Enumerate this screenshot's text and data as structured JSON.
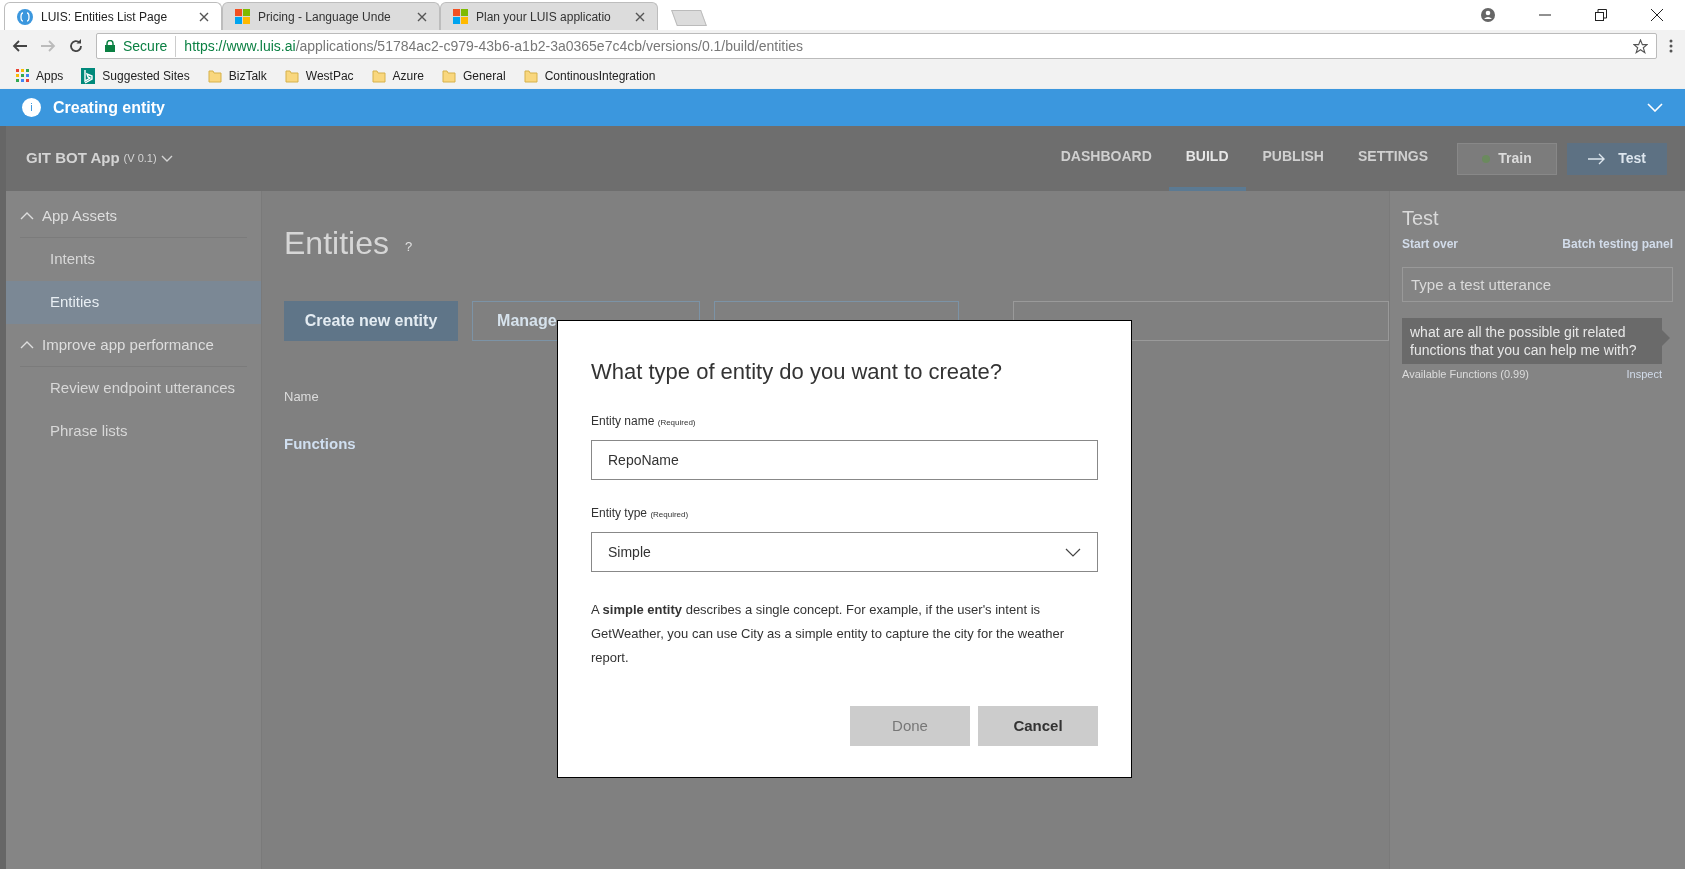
{
  "browser": {
    "tabs": [
      {
        "title": "LUIS: Entities List Page",
        "selected": true
      },
      {
        "title": "Pricing - Language Unde",
        "selected": false
      },
      {
        "title": "Plan your LUIS applicatio",
        "selected": false
      }
    ],
    "secure_label": "Secure",
    "url_host": "https://www.luis.ai",
    "url_path": "/applications/51784ac2-c979-43b6-a1b2-3a0365e7c4cb/versions/0.1/build/entities",
    "bookmarks": [
      {
        "label": "Apps",
        "kind": "apps"
      },
      {
        "label": "Suggested Sites",
        "kind": "bing"
      },
      {
        "label": "BizTalk",
        "kind": "folder"
      },
      {
        "label": "WestPac",
        "kind": "folder"
      },
      {
        "label": "Azure",
        "kind": "folder"
      },
      {
        "label": "General",
        "kind": "folder"
      },
      {
        "label": "ContinousIntegration",
        "kind": "folder"
      }
    ]
  },
  "banner": {
    "icon": "i",
    "text": "Creating entity"
  },
  "header": {
    "app_name": "GIT BOT App",
    "version": "(V 0.1)",
    "nav": [
      {
        "label": "DASHBOARD",
        "selected": false
      },
      {
        "label": "BUILD",
        "selected": true
      },
      {
        "label": "PUBLISH",
        "selected": false
      },
      {
        "label": "SETTINGS",
        "selected": false
      }
    ],
    "train": "Train",
    "test": "Test"
  },
  "sidebar": [
    {
      "label": "App Assets",
      "kind": "section"
    },
    {
      "label": "Intents",
      "kind": "item",
      "selected": false
    },
    {
      "label": "Entities",
      "kind": "item",
      "selected": true
    },
    {
      "label": "Improve app performance",
      "kind": "section"
    },
    {
      "label": "Review endpoint utterances",
      "kind": "item",
      "selected": false
    },
    {
      "label": "Phrase lists",
      "kind": "item",
      "selected": false
    }
  ],
  "main": {
    "title": "Entities",
    "help": "?",
    "create_button": "Create new entity",
    "manage_button": "Manage",
    "name_column": "Name",
    "rows": [
      "Functions"
    ]
  },
  "test_panel": {
    "title": "Test",
    "start_over": "Start over",
    "batch": "Batch testing panel",
    "placeholder": "Type a test utterance",
    "utterance": "what are all the possible git related functions that you can help me with?",
    "result": "Available Functions (0.99)",
    "inspect": "Inspect"
  },
  "dialog": {
    "title": "What type of entity do you want to create?",
    "name_label": "Entity name",
    "name_required": "(Required)",
    "name_value": "RepoName",
    "type_label": "Entity type",
    "type_required": "(Required)",
    "type_value": "Simple",
    "description": "A **simple entity** describes a single concept. For example, if the user's intent is GetWeather, you can use City as a simple entity to capture the city for the weather report.",
    "done": {
      "label": "Done",
      "disabled": true
    },
    "cancel": {
      "label": "Cancel",
      "disabled": false
    }
  }
}
